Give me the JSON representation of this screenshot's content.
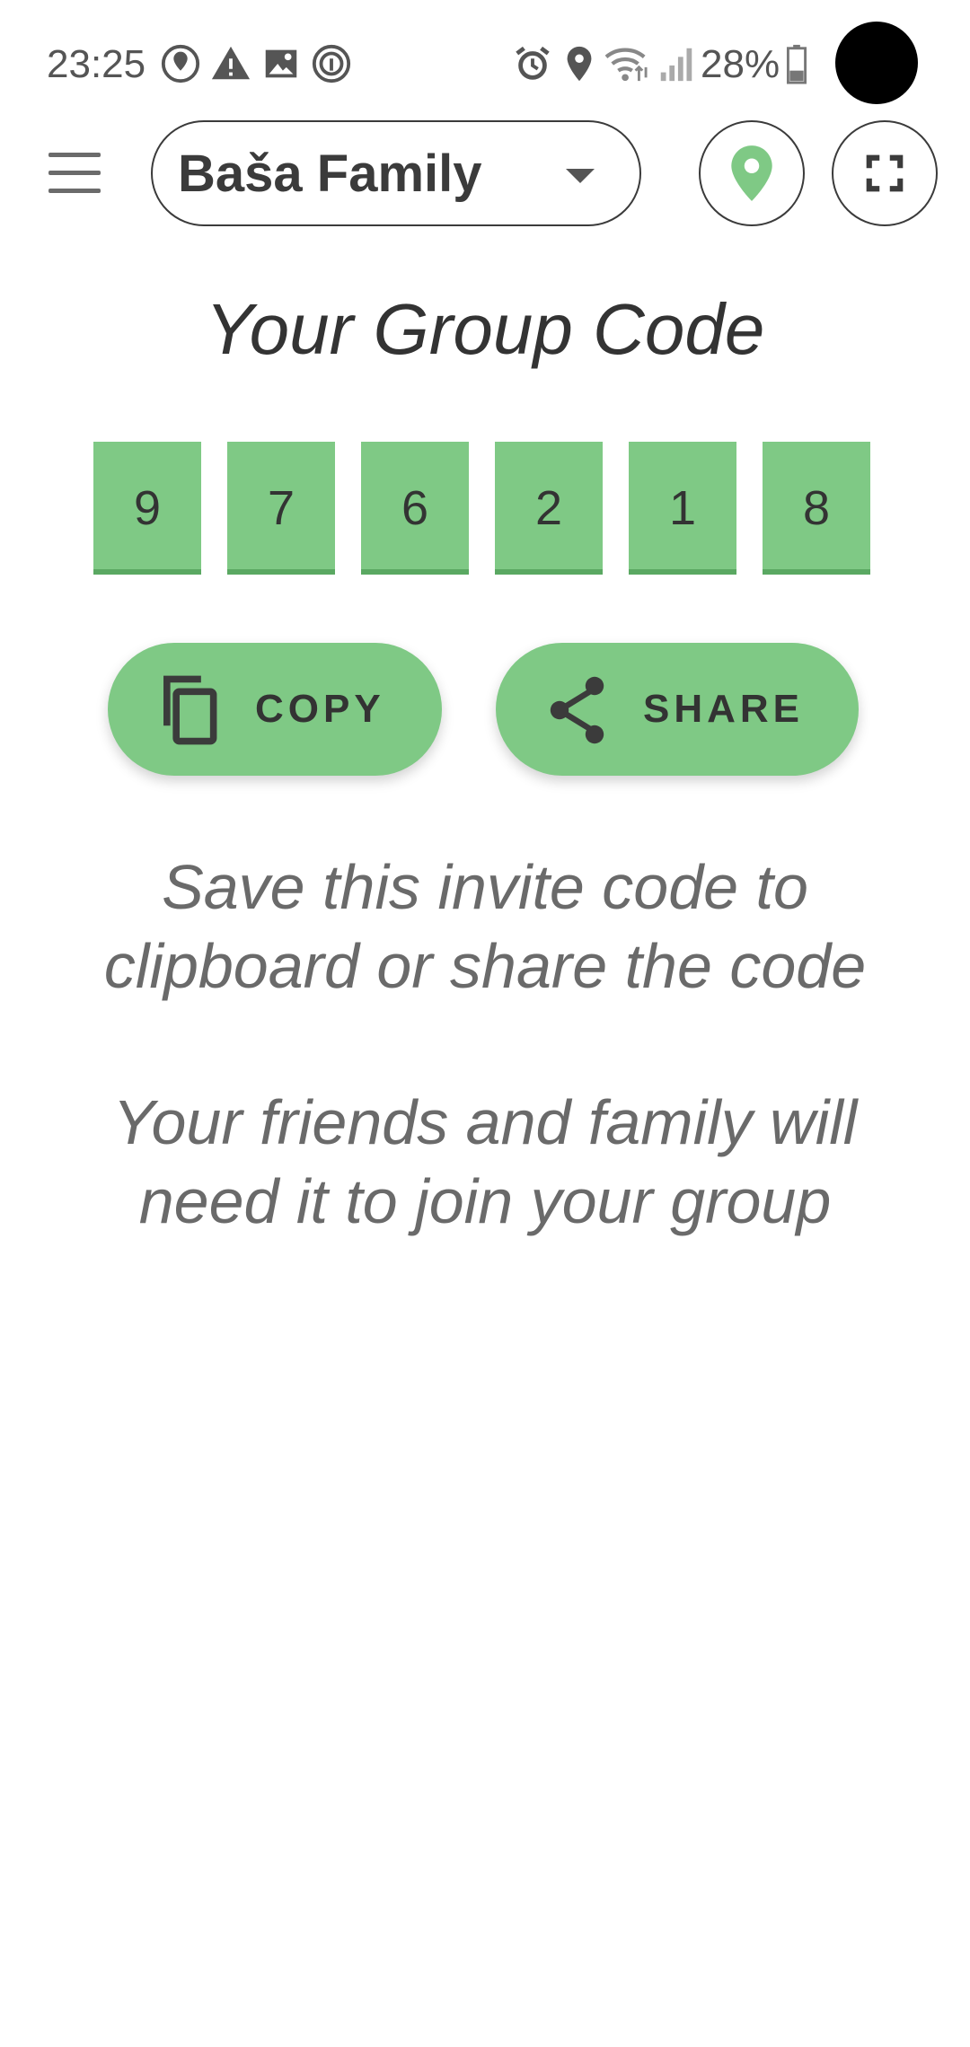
{
  "status_bar": {
    "time": "23:25",
    "battery": "28%",
    "left_icons": [
      "location-sharing-icon",
      "warning-icon",
      "image-icon",
      "fingerprint-icon"
    ],
    "right_icons": [
      "alarm-icon",
      "location-icon",
      "wifi-icon",
      "signal-icon",
      "battery-icon"
    ]
  },
  "app_bar": {
    "group_name": "Baša Family",
    "menu_icon": "menu-icon",
    "location_icon": "location-pin-icon",
    "fullscreen_icon": "fullscreen-icon"
  },
  "main": {
    "title": "Your Group Code",
    "code_digits": [
      "9",
      "7",
      "6",
      "2",
      "1",
      "8"
    ],
    "copy_label": "COPY",
    "share_label": "SHARE",
    "invite_line_1": "Save this invite code to",
    "invite_line_2": "clipboard or share the code",
    "join_line_1": "Your friends and family will",
    "join_line_2": "need it to join your group"
  },
  "colors": {
    "accent_green": "#7fc985",
    "text_dark": "#3a3a3a",
    "text_muted": "#6a6a6a"
  }
}
